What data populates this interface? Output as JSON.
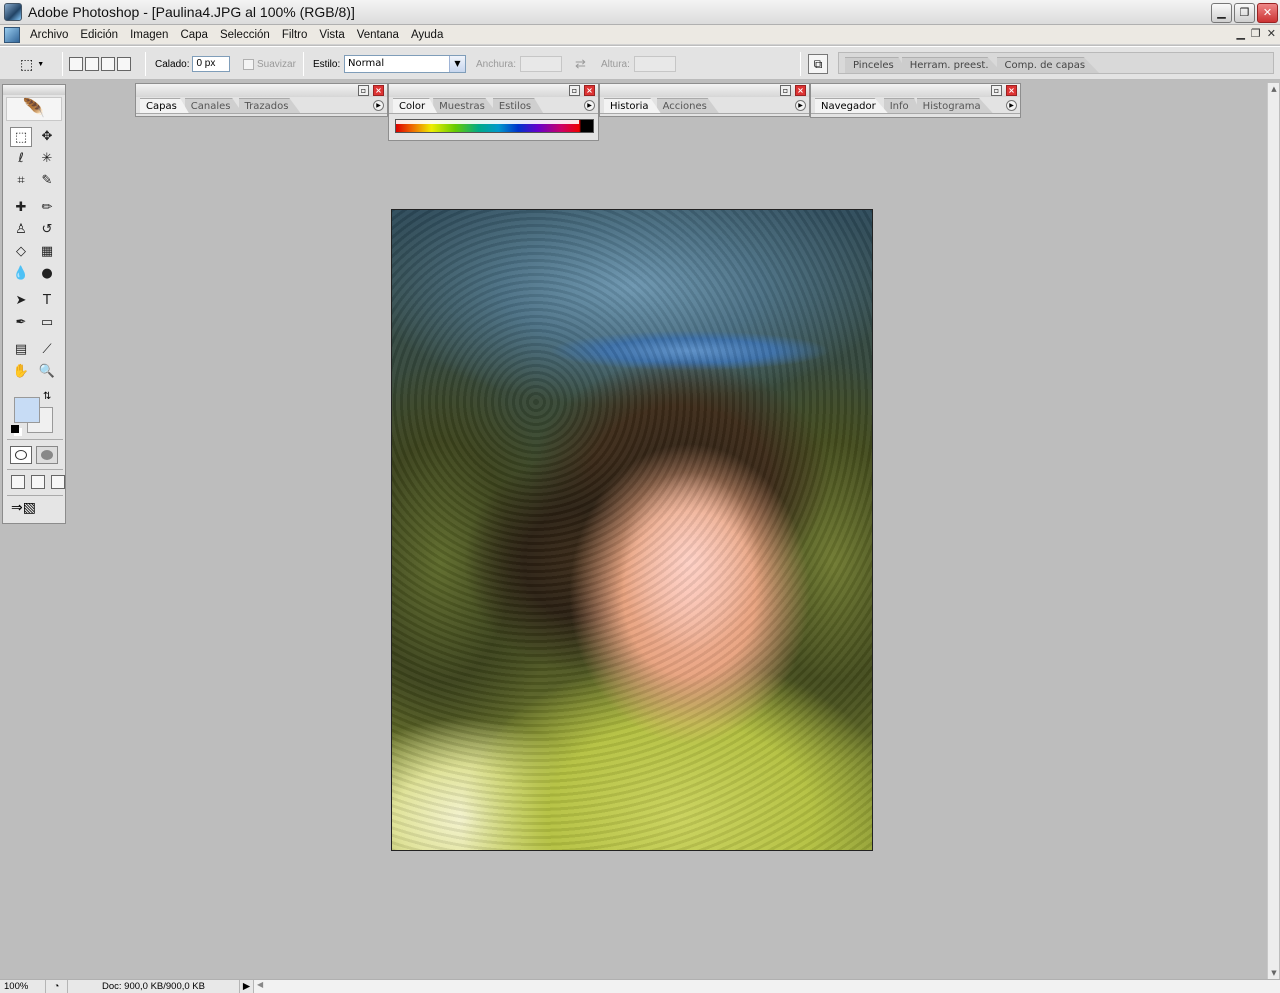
{
  "window": {
    "title": "Adobe Photoshop - [Paulina4.JPG al 100% (RGB/8)]",
    "min": "▁",
    "max": "❐",
    "close": "✕",
    "doc_min": "▁",
    "doc_restore": "❐",
    "doc_close": "✕"
  },
  "menu": [
    "Archivo",
    "Edición",
    "Imagen",
    "Capa",
    "Selección",
    "Filtro",
    "Vista",
    "Ventana",
    "Ayuda"
  ],
  "options": {
    "feather_label": "Calado:",
    "feather_value": "0 px",
    "antialias_label": "Suavizar",
    "style_label": "Estilo:",
    "style_value": "Normal",
    "width_label": "Anchura:",
    "height_label": "Altura:",
    "swap_icon": "⇄"
  },
  "palette_well": [
    "Pinceles",
    "Herram. preest.",
    "Comp. de capas"
  ],
  "palettes": {
    "layers": [
      "Capas",
      "Canales",
      "Trazados"
    ],
    "color": [
      "Color",
      "Muestras",
      "Estilos"
    ],
    "history": [
      "Historia",
      "Acciones"
    ],
    "navigator": [
      "Navegador",
      "Info",
      "Histograma"
    ]
  },
  "toolbox": {
    "fg_color": "#c7dcf5",
    "bg_color": "#f0f0f0",
    "tools": [
      {
        "name": "marquee-tool-icon",
        "glyph": "⬚"
      },
      {
        "name": "move-tool-icon",
        "glyph": "✥"
      },
      {
        "name": "lasso-tool-icon",
        "glyph": "ℓ"
      },
      {
        "name": "magic-wand-tool-icon",
        "glyph": "✳"
      },
      {
        "name": "crop-tool-icon",
        "glyph": "⌗"
      },
      {
        "name": "slice-tool-icon",
        "glyph": "✎"
      },
      {
        "name": "healing-brush-tool-icon",
        "glyph": "✚"
      },
      {
        "name": "brush-tool-icon",
        "glyph": "✏"
      },
      {
        "name": "clone-stamp-tool-icon",
        "glyph": "♙"
      },
      {
        "name": "history-brush-tool-icon",
        "glyph": "↺"
      },
      {
        "name": "eraser-tool-icon",
        "glyph": "◇"
      },
      {
        "name": "gradient-tool-icon",
        "glyph": "▦"
      },
      {
        "name": "blur-tool-icon",
        "glyph": "💧"
      },
      {
        "name": "dodge-tool-icon",
        "glyph": "●"
      },
      {
        "name": "path-selection-tool-icon",
        "glyph": "➤"
      },
      {
        "name": "type-tool-icon",
        "glyph": "T"
      },
      {
        "name": "pen-tool-icon",
        "glyph": "✒"
      },
      {
        "name": "shape-tool-icon",
        "glyph": "▭"
      },
      {
        "name": "notes-tool-icon",
        "glyph": "▤"
      },
      {
        "name": "eyedropper-tool-icon",
        "glyph": "⟋"
      },
      {
        "name": "hand-tool-icon",
        "glyph": "✋"
      },
      {
        "name": "zoom-tool-icon",
        "glyph": "🔍"
      }
    ]
  },
  "status": {
    "zoom": "100%",
    "doc": "Doc: 900,0 KB/900,0 KB"
  }
}
